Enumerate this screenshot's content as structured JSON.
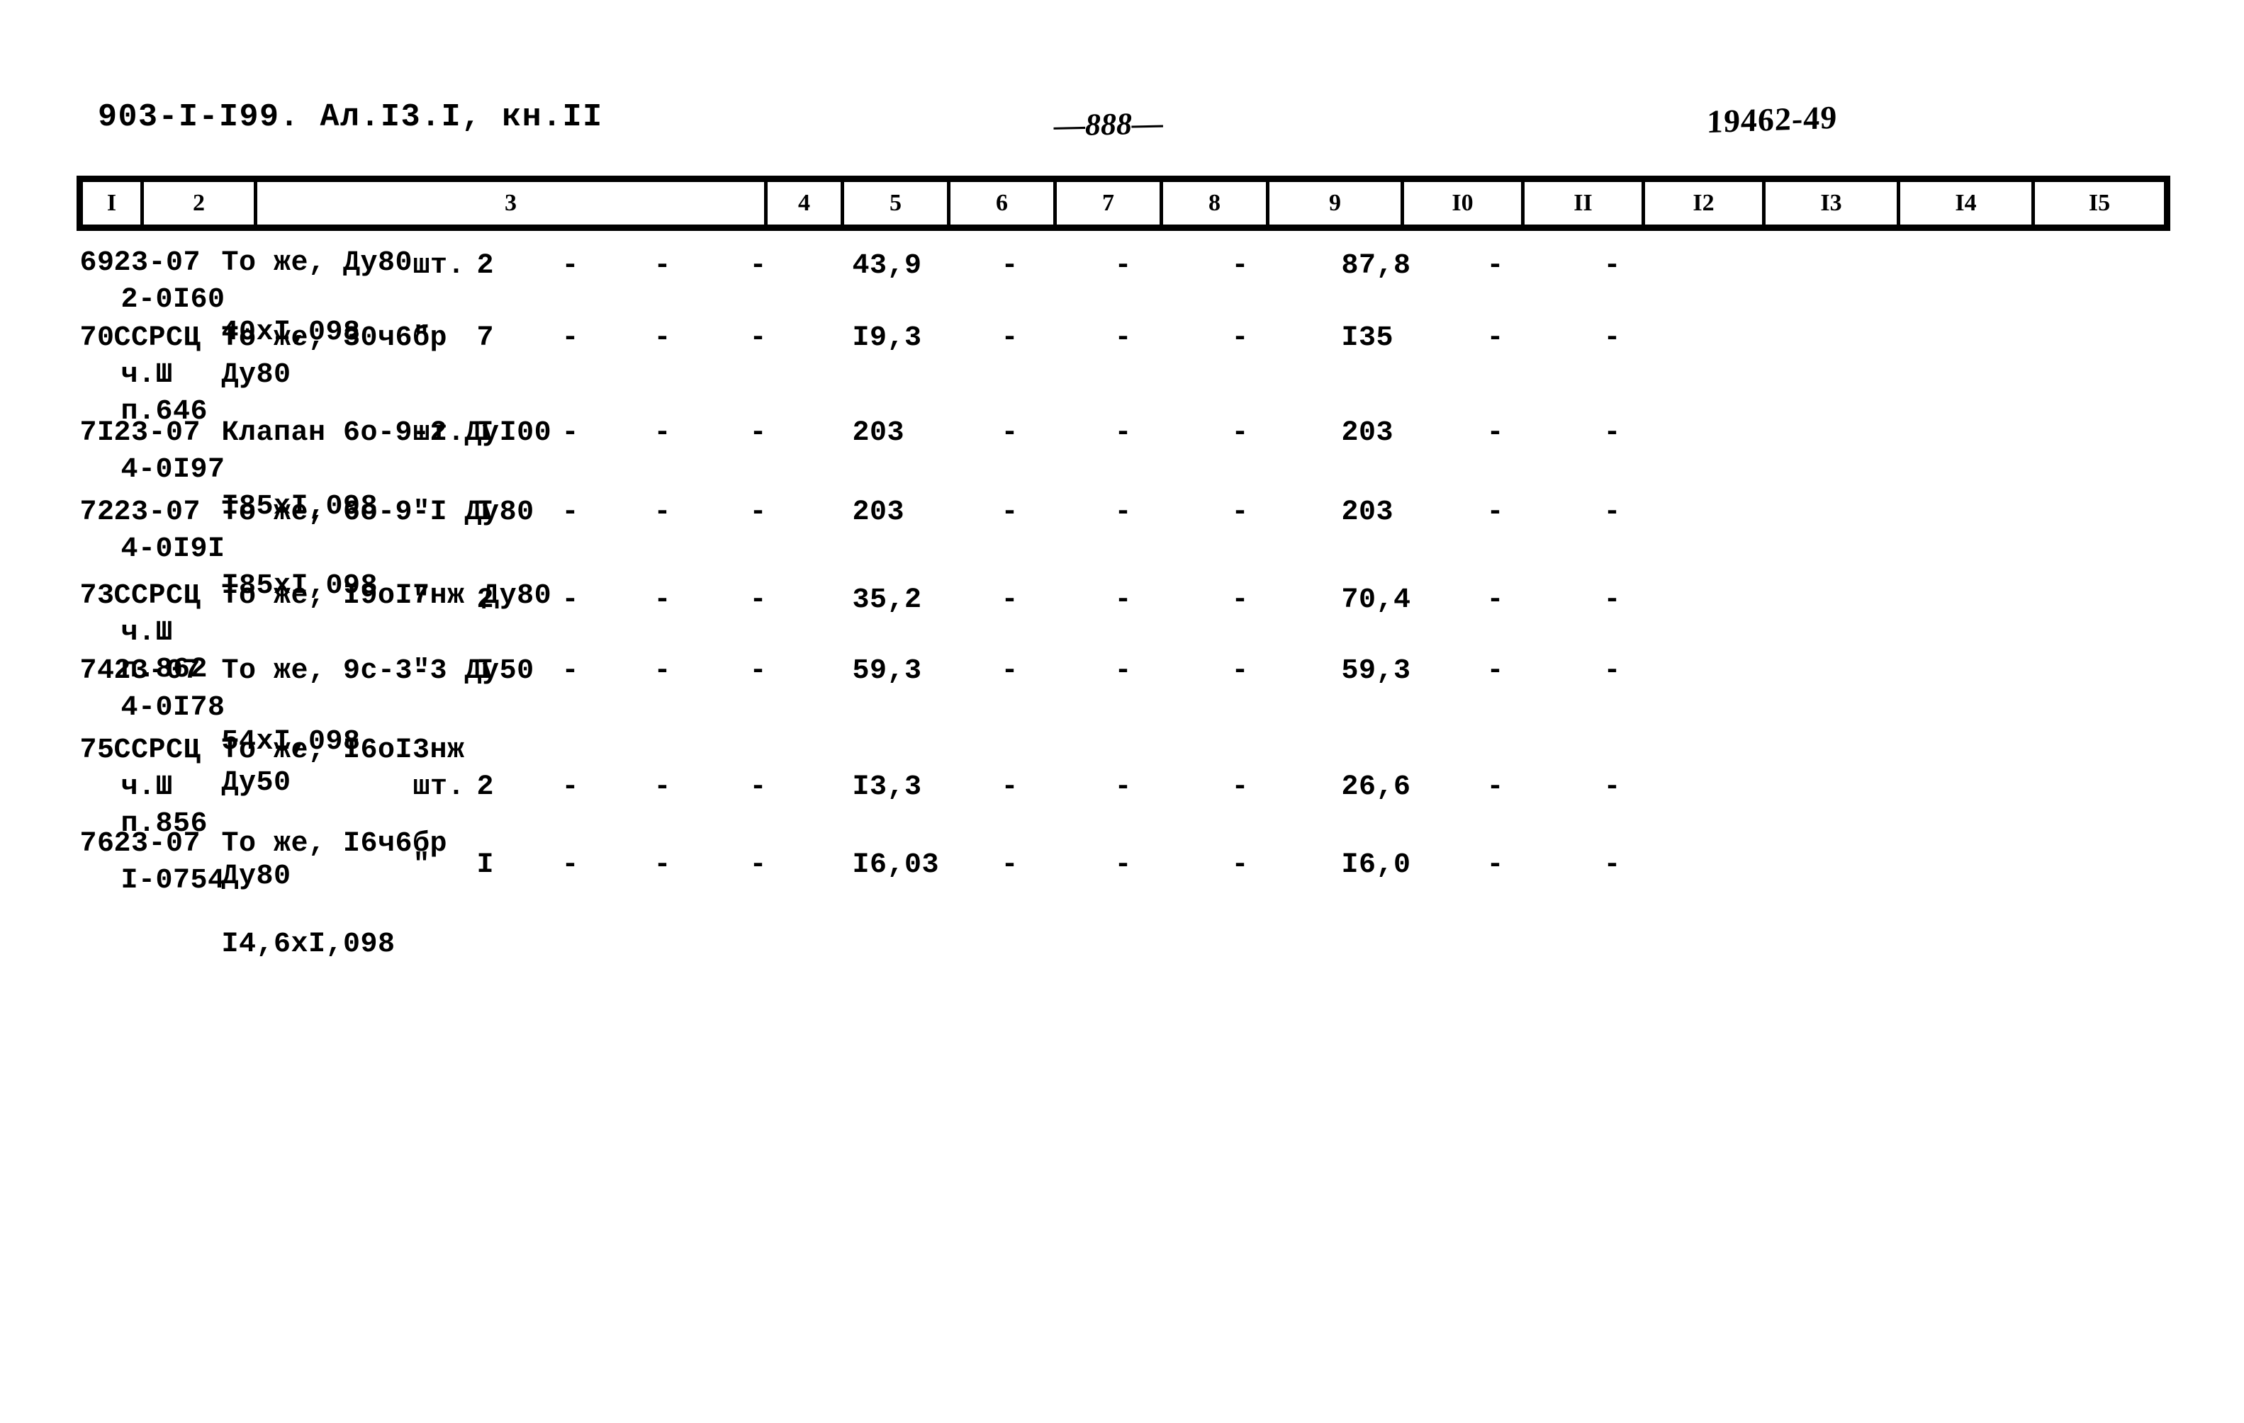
{
  "header": {
    "doc_code": "903-I-I99. Ал.I3.I, кн.II",
    "page_number": "—888—",
    "archive_code": "19462-49"
  },
  "table": {
    "column_headers": [
      "I",
      "2",
      "3",
      "4",
      "5",
      "6",
      "7",
      "8",
      "9",
      "I0",
      "II",
      "I2",
      "I3",
      "I4",
      "I5"
    ],
    "dash": "-",
    "rows": [
      {
        "num": "69",
        "code_line1": "23-07",
        "code_line2": "2-0I60",
        "desc_line1": "То же, Ду80",
        "desc_line2": "",
        "desc_line3": "40xI,098",
        "unit": "шт.",
        "qty": "2",
        "col6": "-",
        "col7": "-",
        "col8": "-",
        "col9": "43,9",
        "col10": "-",
        "col11": "-",
        "col12": "-",
        "col13": "87,8",
        "col14": "-",
        "col15": "-"
      },
      {
        "num": "70",
        "code_line1": "ССРСЦ",
        "code_line2": "ч.Ш",
        "code_line3": "п.646",
        "desc_line1": "То же, 30ч6бр",
        "desc_line2": "Ду80",
        "desc_line3": "",
        "unit": "\"",
        "qty": "7",
        "col6": "-",
        "col7": "-",
        "col8": "-",
        "col9": "I9,3",
        "col10": "-",
        "col11": "-",
        "col12": "-",
        "col13": "I35",
        "col14": "-",
        "col15": "-"
      },
      {
        "num": "7I",
        "code_line1": "23-07",
        "code_line2": "4-0I97",
        "desc_line1": "Клапан 6о-9-2 ДуI00",
        "desc_line2": "",
        "desc_line3": "I85xI,098",
        "unit": "шт.",
        "qty": "I",
        "col6": "-",
        "col7": "-",
        "col8": "-",
        "col9": "203",
        "col10": "-",
        "col11": "-",
        "col12": "-",
        "col13": "203",
        "col14": "-",
        "col15": "-"
      },
      {
        "num": "72",
        "code_line1": "23-07",
        "code_line2": "4-0I9I",
        "desc_line1": "То же, 6о-9-I Ду80",
        "desc_line2": "",
        "desc_line3": "I85xI,098",
        "unit": "\"",
        "qty": "I",
        "col6": "-",
        "col7": "-",
        "col8": "-",
        "col9": "203",
        "col10": "-",
        "col11": "-",
        "col12": "-",
        "col13": "203",
        "col14": "-",
        "col15": "-"
      },
      {
        "num": "73",
        "code_line1": "ССРСЦ",
        "code_line2": "ч.Ш",
        "code_line3": "п.862",
        "desc_line1": "То же, I9оI7нж Ду80",
        "desc_line2": "",
        "desc_line3": "",
        "unit": "\"",
        "qty": "2",
        "col6": "-",
        "col7": "-",
        "col8": "-",
        "col9": "35,2",
        "col10": "-",
        "col11": "-",
        "col12": "-",
        "col13": "70,4",
        "col14": "-",
        "col15": "-"
      },
      {
        "num": "74",
        "code_line1": "23-07",
        "code_line2": "4-0I78",
        "desc_line1": "То же, 9с-3-3 Ду50",
        "desc_line2": "",
        "desc_line3": "54xI,098",
        "unit": "\"",
        "qty": "I",
        "col6": "-",
        "col7": "-",
        "col8": "-",
        "col9": "59,3",
        "col10": "-",
        "col11": "-",
        "col12": "-",
        "col13": "59,3",
        "col14": "-",
        "col15": "-"
      },
      {
        "num": "75",
        "code_line1": "ССРСЦ",
        "code_line2": "ч.Ш",
        "code_line3": "п.856",
        "desc_line1": "То же, I6оI3нж",
        "desc_line2": "Ду50",
        "desc_line3": "",
        "unit": "шт.",
        "qty": "2",
        "col6": "-",
        "col7": "-",
        "col8": "-",
        "col9": "I3,3",
        "col10": "-",
        "col11": "-",
        "col12": "-",
        "col13": "26,6",
        "col14": "-",
        "col15": "-"
      },
      {
        "num": "76",
        "code_line1": "23-07",
        "code_line2": "I-0754",
        "desc_line1": "То же, I6ч6бр",
        "desc_line2": "Ду80",
        "desc_line3": "I4,6xI,098",
        "unit": "\"",
        "qty": "I",
        "col6": "-",
        "col7": "-",
        "col8": "-",
        "col9": "I6,03",
        "col10": "-",
        "col11": "-",
        "col12": "-",
        "col13": "I6,0",
        "col14": "-",
        "col15": "-"
      }
    ]
  }
}
